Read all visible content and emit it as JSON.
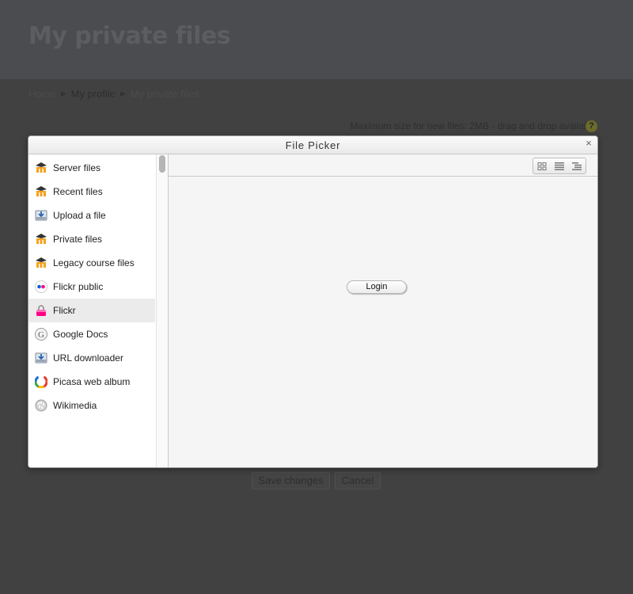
{
  "page": {
    "title": "My private files",
    "breadcrumb": [
      "Home",
      "My profile",
      "My private files"
    ],
    "max_size_text": "Maximum size for new files: 2MB - drag and drop available",
    "help_icon": "?",
    "save_label": "Save changes",
    "cancel_label": "Cancel"
  },
  "dialog": {
    "title": "File Picker",
    "close_glyph": "×",
    "sidebar": {
      "active_index": 6,
      "items": [
        {
          "label": "Server files",
          "icon": "moodle-icon"
        },
        {
          "label": "Recent files",
          "icon": "moodle-icon"
        },
        {
          "label": "Upload a file",
          "icon": "upload-icon"
        },
        {
          "label": "Private files",
          "icon": "moodle-icon"
        },
        {
          "label": "Legacy course files",
          "icon": "moodle-icon"
        },
        {
          "label": "Flickr public",
          "icon": "flickr-icon"
        },
        {
          "label": "Flickr",
          "icon": "flickr-lock-icon"
        },
        {
          "label": "Google Docs",
          "icon": "google-icon"
        },
        {
          "label": "URL downloader",
          "icon": "url-download-icon"
        },
        {
          "label": "Picasa web album",
          "icon": "picasa-icon"
        },
        {
          "label": "Wikimedia",
          "icon": "wikimedia-icon"
        }
      ]
    },
    "toolbar": {
      "views": [
        "icons-view-icon",
        "list-view-icon",
        "tree-view-icon"
      ]
    },
    "login_label": "Login"
  },
  "colors": {
    "overlay_bg": "#414141",
    "dialog_bg": "#f5f5f5",
    "active_item_bg": "#ebebeb",
    "moodle_orange": "#f6a21e"
  }
}
